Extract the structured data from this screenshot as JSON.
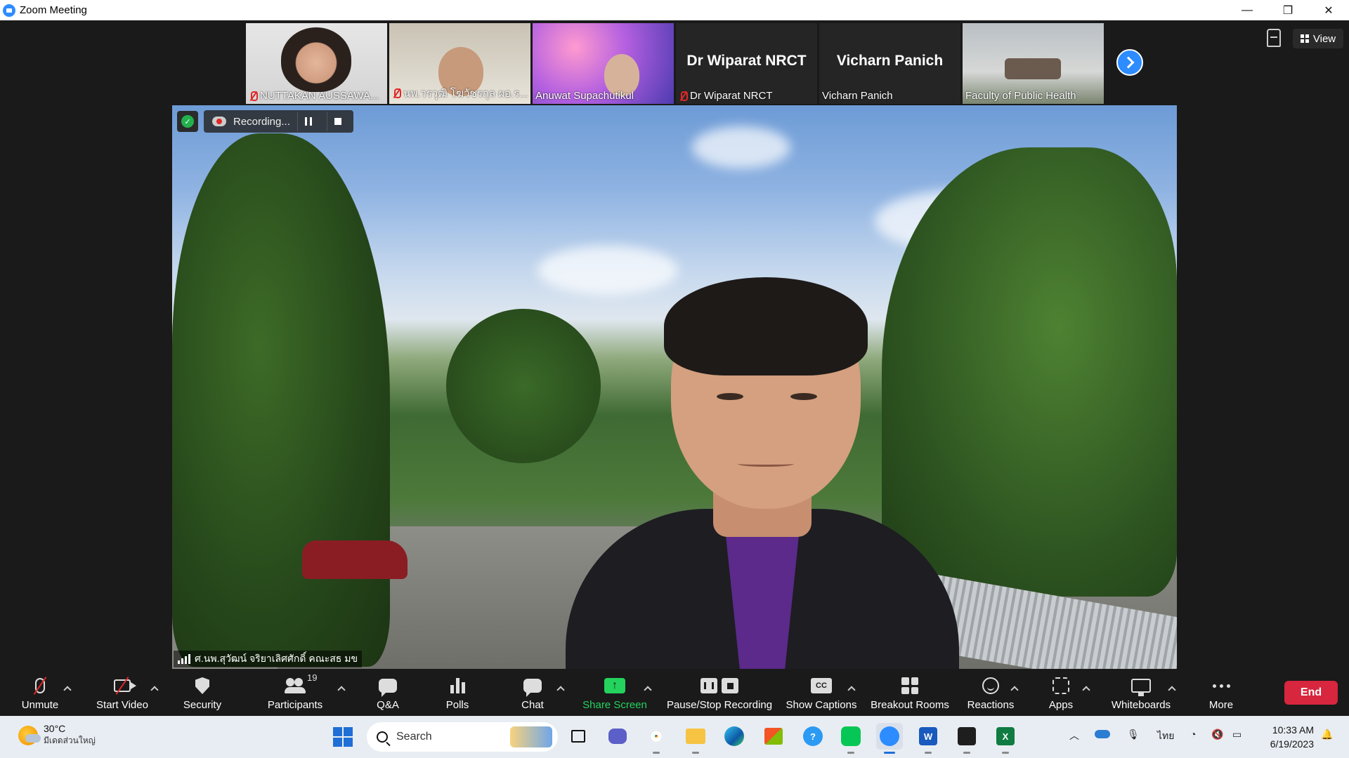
{
  "window": {
    "title": "Zoom Meeting",
    "controls": [
      "—",
      "❐",
      "✕"
    ]
  },
  "gallery": {
    "tiles": [
      {
        "name": "NUTTAKAN AUSSAWA...",
        "muted": true,
        "type": "video"
      },
      {
        "name": "นพ.วรวุฒิ โฆวัชรกุล ผอ.ร...",
        "muted": true,
        "type": "video"
      },
      {
        "name": "Anuwat Supachutikul",
        "muted": false,
        "type": "video"
      },
      {
        "name": "Dr Wiparat NRCT",
        "big_name": "Dr Wiparat NRCT",
        "muted": true,
        "type": "name"
      },
      {
        "name": "Vicharn Panich",
        "big_name": "Vicharn Panich",
        "muted": false,
        "type": "name"
      },
      {
        "name": "Faculty of Public Health",
        "muted": false,
        "type": "video"
      }
    ],
    "view_label": "View"
  },
  "speaker": {
    "name": "ศ.นพ.สุวัฒน์ จริยาเลิศศักดิ์ คณะสธ มข",
    "recording_label": "Recording..."
  },
  "toolbar": {
    "unmute": "Unmute",
    "start_video": "Start Video",
    "security": "Security",
    "participants": "Participants",
    "participant_count": "19",
    "qa": "Q&A",
    "polls": "Polls",
    "chat": "Chat",
    "share_screen": "Share Screen",
    "pause_stop_recording": "Pause/Stop Recording",
    "show_captions": "Show Captions",
    "cc_glyph": "CC",
    "breakout_rooms": "Breakout Rooms",
    "reactions": "Reactions",
    "apps": "Apps",
    "whiteboards": "Whiteboards",
    "more": "More",
    "end": "End"
  },
  "taskbar": {
    "weather_temp": "30°C",
    "weather_desc": "มีเดดส่วนใหญ่",
    "search_placeholder": "Search",
    "language": "ไทย",
    "time": "10:33 AM",
    "date": "6/19/2023",
    "colors": {
      "accent": "#1f6fd6",
      "zoom": "#2d8cff",
      "end": "#d7263d",
      "share": "#23d35d"
    }
  }
}
